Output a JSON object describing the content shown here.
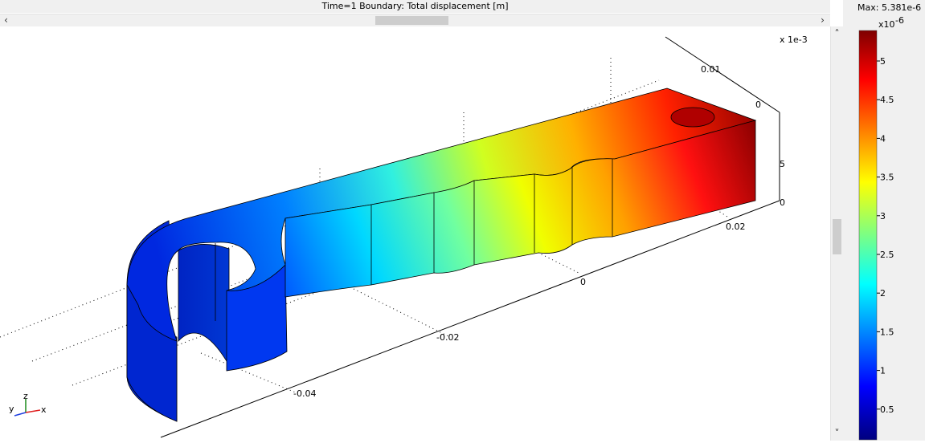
{
  "header": {
    "title": "Time=1    Boundary: Total displacement [m]"
  },
  "scrollbars": {
    "left_arrow": "‹",
    "right_arrow": "›",
    "up_arrow": "˄",
    "down_arrow": "˅"
  },
  "axes": {
    "scale_label": "x 1e-3",
    "x_ticks": [
      "-0.04",
      "-0.02",
      "0",
      "0.02"
    ],
    "y_ticks": [
      "0.01",
      "0"
    ],
    "z_ticks": [
      "5",
      "0"
    ],
    "triad": {
      "x": "x",
      "y": "y",
      "z": "z"
    }
  },
  "colorbar": {
    "max_label": "Max: 5.381e-6",
    "exponent_base": "x10",
    "exponent": "-6",
    "ticks": [
      "5",
      "4.5",
      "4",
      "3.5",
      "3",
      "2.5",
      "2",
      "1.5",
      "1",
      "0.5"
    ],
    "colormap": [
      "#7f0000",
      "#ff0000",
      "#ffff00",
      "#00ffff",
      "#0000ff",
      "#00007f"
    ]
  }
}
